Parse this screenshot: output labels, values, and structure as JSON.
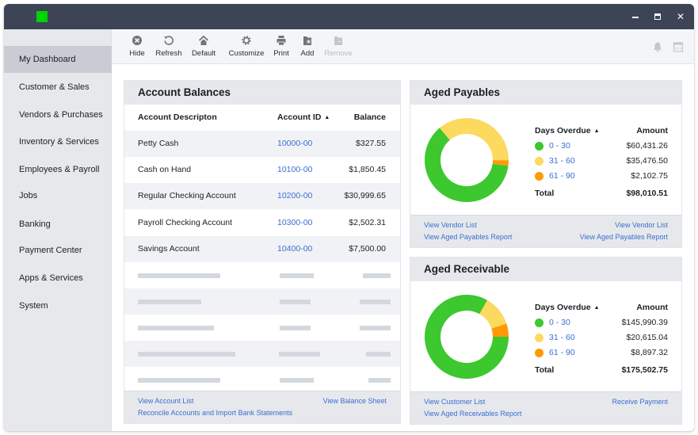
{
  "window": {
    "controls": {
      "minimize": "minimize",
      "maximize": "maximize",
      "close": "✕"
    },
    "brand_color": "#00d400"
  },
  "sidebar": {
    "items": [
      {
        "label": "My Dashboard",
        "active": true
      },
      {
        "label": "Customer & Sales"
      },
      {
        "label": "Vendors & Purchases"
      },
      {
        "label": "Inventory & Services"
      },
      {
        "label": "Employees & Payroll"
      },
      {
        "label": "Jobs"
      },
      {
        "label": "Banking"
      },
      {
        "label": "Payment Center"
      },
      {
        "label": "Apps & Services"
      },
      {
        "label": "System"
      }
    ]
  },
  "toolbar": {
    "buttons": [
      {
        "label": "Hide",
        "icon": "close-circle-icon"
      },
      {
        "label": "Refresh",
        "icon": "refresh-icon"
      },
      {
        "label": "Default",
        "icon": "home-icon"
      },
      {
        "label": "Customize",
        "icon": "gear-icon"
      },
      {
        "label": "Print",
        "icon": "printer-icon"
      },
      {
        "label": "Add",
        "icon": "folder-add-icon"
      },
      {
        "label": "Remove",
        "icon": "folder-remove-icon",
        "disabled": true
      }
    ],
    "right_icons": [
      "bell-icon",
      "calendar-icon"
    ]
  },
  "account_balances": {
    "title": "Account Balances",
    "columns": {
      "description": "Account Descripton",
      "account_id": "Account ID",
      "sort_indicator": "▲",
      "balance": "Balance"
    },
    "rows": [
      {
        "description": "Petty Cash",
        "account_id": "10000-00",
        "balance": "$327.55"
      },
      {
        "description": "Cash on Hand",
        "account_id": "10100-00",
        "balance": "$1,850.45"
      },
      {
        "description": "Regular Checking Account",
        "account_id": "10200-00",
        "balance": "$30,999.65"
      },
      {
        "description": "Payroll Checking Account",
        "account_id": "10300-00",
        "balance": "$2,502.31"
      },
      {
        "description": "Savings Account",
        "account_id": "10400-00",
        "balance": "$7,500.00"
      }
    ],
    "placeholder_rows": 5,
    "footer_links": {
      "view_account_list": "View Account List",
      "reconcile": "Reconcile Accounts and Import Bank Statements",
      "view_balance_sheet": "View Balance Sheet"
    }
  },
  "aged_payables": {
    "title": "Aged Payables",
    "legend_header": {
      "label": "Days Overdue",
      "sort_indicator": "▲",
      "amount": "Amount"
    },
    "buckets": [
      {
        "label": "0 - 30",
        "amount": "$60,431.26",
        "value": 60431.26,
        "color": "#3cc82e"
      },
      {
        "label": "31 - 60",
        "amount": "$35,476.50",
        "value": 35476.5,
        "color": "#fcd95f"
      },
      {
        "label": "61 - 90",
        "amount": "$2,102.75",
        "value": 2102.75,
        "color": "#ff9a05"
      }
    ],
    "total": {
      "label": "Total",
      "amount": "$98,010.51"
    },
    "footer_links": {
      "left_1": "View Vendor List",
      "left_2": "View Aged Payables Report",
      "right_1": "View Vendor List",
      "right_2": "View Aged Payables Report"
    }
  },
  "aged_receivable": {
    "title": "Aged Receivable",
    "legend_header": {
      "label": "Days Overdue",
      "sort_indicator": "▲",
      "amount": "Amount"
    },
    "buckets": [
      {
        "label": "0 - 30",
        "amount": "$145,990.39",
        "value": 145990.39,
        "color": "#3cc82e"
      },
      {
        "label": "31 - 60",
        "amount": "$20,615.04",
        "value": 20615.04,
        "color": "#fcd95f"
      },
      {
        "label": "61 - 90",
        "amount": "$8,897.32",
        "value": 8897.32,
        "color": "#ff9a05"
      }
    ],
    "total": {
      "label": "Total",
      "amount": "$175,502.75"
    },
    "footer_links": {
      "left_1": "View Customer List",
      "left_2": "View Aged Receivables Report",
      "right_1": "Receive Payment"
    }
  },
  "chart_data": [
    {
      "type": "pie",
      "title": "Aged Payables",
      "categories": [
        "0 - 30",
        "31 - 60",
        "61 - 90"
      ],
      "values": [
        60431.26,
        35476.5,
        2102.75
      ],
      "colors": [
        "#3cc82e",
        "#fcd95f",
        "#ff9a05"
      ],
      "donut": true
    },
    {
      "type": "pie",
      "title": "Aged Receivable",
      "categories": [
        "0 - 30",
        "31 - 60",
        "61 - 90"
      ],
      "values": [
        145990.39,
        20615.04,
        8897.32
      ],
      "colors": [
        "#3cc82e",
        "#fcd95f",
        "#ff9a05"
      ],
      "donut": true
    }
  ]
}
